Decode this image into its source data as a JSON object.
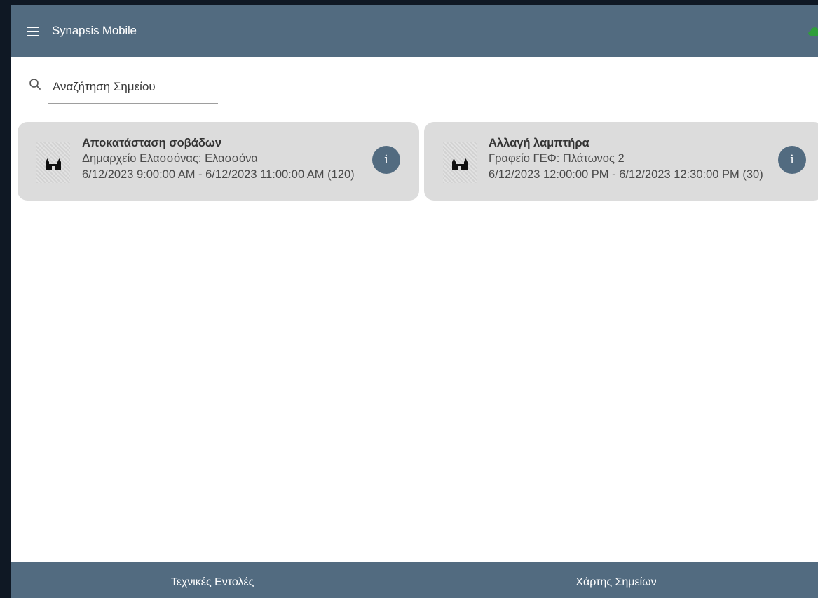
{
  "header": {
    "title": "Synapsis Mobile",
    "menu_icon": "menu-icon",
    "sync_icon": "cloud-icon",
    "sync_color": "#2e9e3a"
  },
  "search": {
    "placeholder": "Αναζήτηση Σημείου",
    "value": ""
  },
  "tasks": [
    {
      "title": "Αποκατάσταση σοβάδων",
      "location": "Δημαρχείο Ελασσόνας: Ελασσόνα",
      "time": "6/12/2023 9:00:00 AM - 6/12/2023 11:00:00 AM (120)",
      "info_label": "i"
    },
    {
      "title": "Αλλαγή λαμπτήρα",
      "location": "Γραφείο ΓΕΦ: Πλάτωνος 2",
      "time": "6/12/2023 12:00:00 PM - 6/12/2023 12:30:00 PM (30)",
      "info_label": "i"
    }
  ],
  "bottom_nav": {
    "tab1": "Τεχνικές Εντολές",
    "tab2": "Χάρτης Σημείων"
  },
  "colors": {
    "primary": "#526b80",
    "card_bg": "#dcdcdc"
  }
}
